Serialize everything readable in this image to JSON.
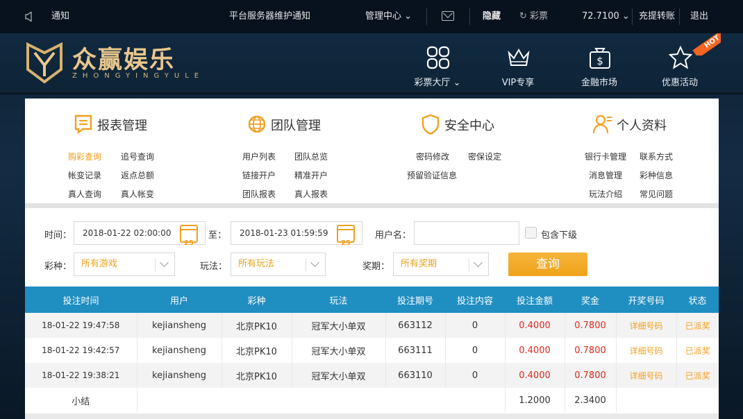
{
  "topbar": {
    "notice_label": "通知",
    "maintenance": "平台服务器维护通知",
    "management": "管理中心",
    "hide": "隐藏",
    "lottery_ticket": "彩票",
    "balance": "72.7100",
    "recharge": "充提转账",
    "logout": "退出"
  },
  "header": {
    "logo_cn": "众赢娱乐",
    "logo_en": "ZHONGYINGYULE",
    "nav": [
      {
        "label": "彩票大厅",
        "icon": "grid-icon"
      },
      {
        "label": "VIP专享",
        "icon": "crown-icon"
      },
      {
        "label": "金融市场",
        "icon": "money-bag-icon"
      },
      {
        "label": "优惠活动",
        "icon": "star-icon"
      }
    ],
    "hot_badge": "HOT"
  },
  "categories": [
    {
      "title": "报表管理",
      "icon": "report-icon",
      "links": [
        "购彩查询",
        "追号查询",
        "帐变记录",
        "返点总额",
        "真人查询",
        "真人帐变"
      ]
    },
    {
      "title": "团队管理",
      "icon": "globe-icon",
      "links": [
        "用户列表",
        "团队总览",
        "链接开户",
        "精准开户",
        "团队报表",
        "真人报表"
      ]
    },
    {
      "title": "安全中心",
      "icon": "shield-icon",
      "links": [
        "密码修改",
        "密保设定",
        "预留验证信息"
      ]
    },
    {
      "title": "个人资料",
      "icon": "user-icon",
      "links": [
        "银行卡管理",
        "联系方式",
        "消息管理",
        "彩种信息",
        "玩法介绍",
        "常见问题"
      ]
    }
  ],
  "filters": {
    "time_label": "时间：",
    "start_time": "2018-01-22 02:00:00",
    "to_label": "至：",
    "end_time": "2018-01-23 01:59:59",
    "calendar_day": "25",
    "username_label": "用户名：",
    "username_value": "",
    "include_sub": "包含下级",
    "lottery_label": "彩种：",
    "lottery_value": "所有游戏",
    "play_label": "玩法：",
    "play_value": "所有玩法",
    "period_label": "奖期：",
    "period_value": "所有奖期",
    "query_button": "查询"
  },
  "table": {
    "headers": [
      "投注时间",
      "用户",
      "彩种",
      "玩法",
      "投注期号",
      "投注内容",
      "投注金额",
      "奖金",
      "开奖号码",
      "状态"
    ],
    "rows": [
      [
        "18-01-22 19:47:58",
        "kejiansheng",
        "北京PK10",
        "冠军大小单双",
        "663112",
        "0",
        "0.4000",
        "0.7800",
        "详细号码",
        "已派奖"
      ],
      [
        "18-01-22 19:42:57",
        "kejiansheng",
        "北京PK10",
        "冠军大小单双",
        "663111",
        "0",
        "0.4000",
        "0.7800",
        "详细号码",
        "已派奖"
      ],
      [
        "18-01-22 19:38:21",
        "kejiansheng",
        "北京PK10",
        "冠军大小单双",
        "663110",
        "0",
        "0.4000",
        "0.7800",
        "详细号码",
        "已派奖"
      ]
    ],
    "summary": {
      "label": "小结",
      "amount": "1.2000",
      "prize": "2.3400"
    }
  },
  "colors": {
    "accent": "#1f8ec1",
    "orange": "#f0a020",
    "red": "#e2271f",
    "gold": "#e9c78c"
  }
}
